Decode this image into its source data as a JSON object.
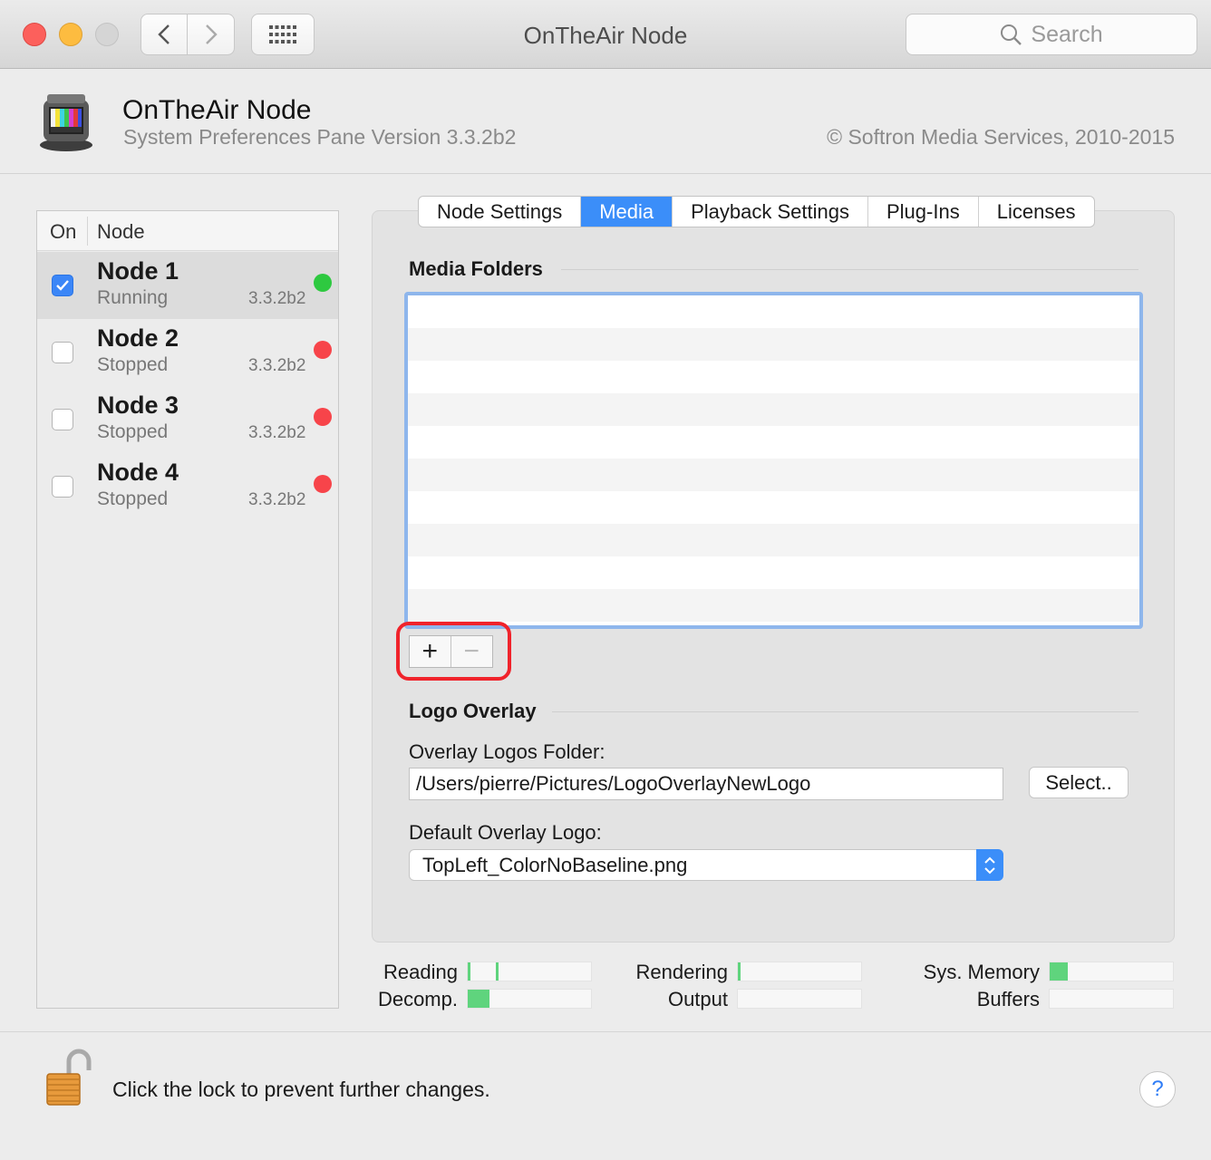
{
  "window": {
    "title": "OnTheAir Node",
    "search_placeholder": "Search"
  },
  "header": {
    "app_name": "OnTheAir Node",
    "version_text": "System Preferences Pane Version 3.3.2b2",
    "copyright": "© Softron Media Services, 2010-2015"
  },
  "node_list": {
    "col_on": "On",
    "col_node": "Node",
    "nodes": [
      {
        "name": "Node 1",
        "status": "Running",
        "version": "3.3.2b2",
        "enabled": true,
        "status_color": "#2ec940"
      },
      {
        "name": "Node 2",
        "status": "Stopped",
        "version": "3.3.2b2",
        "enabled": false,
        "status_color": "#f7444a"
      },
      {
        "name": "Node 3",
        "status": "Stopped",
        "version": "3.3.2b2",
        "enabled": false,
        "status_color": "#f7444a"
      },
      {
        "name": "Node 4",
        "status": "Stopped",
        "version": "3.3.2b2",
        "enabled": false,
        "status_color": "#f7444a"
      }
    ]
  },
  "tabs": [
    {
      "label": "Node Settings",
      "active": false
    },
    {
      "label": "Media",
      "active": true
    },
    {
      "label": "Playback Settings",
      "active": false
    },
    {
      "label": "Plug-Ins",
      "active": false
    },
    {
      "label": "Licenses",
      "active": false
    }
  ],
  "media": {
    "section_title": "Media Folders",
    "folders": [],
    "add_label": "+",
    "remove_label": "−"
  },
  "logo_overlay": {
    "section_title": "Logo Overlay",
    "folder_label": "Overlay Logos Folder:",
    "folder_value": "/Users/pierre/Pictures/LogoOverlayNewLogo",
    "select_button": "Select..",
    "default_label": "Default Overlay Logo:",
    "default_value": "TopLeft_ColorNoBaseline.png"
  },
  "meters": {
    "reading": {
      "label": "Reading",
      "level": 0.02,
      "marker": 0.23
    },
    "decomp": {
      "label": "Decomp.",
      "level": 0.18
    },
    "rendering": {
      "label": "Rendering",
      "level": 0.02
    },
    "output": {
      "label": "Output",
      "level": 0
    },
    "sys_memory": {
      "label": "Sys. Memory",
      "level": 0.15
    },
    "buffers": {
      "label": "Buffers",
      "level": 0
    }
  },
  "footer": {
    "lock_text": "Click the lock to prevent further changes.",
    "help_label": "?"
  },
  "colors": {
    "accent": "#3b8ef9",
    "meter_green": "#5fd47d",
    "highlight_red": "#f0232b"
  }
}
